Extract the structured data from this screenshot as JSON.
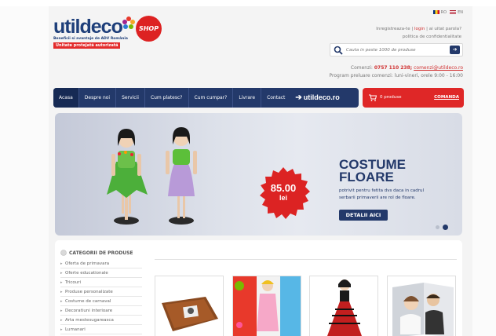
{
  "colors": {
    "brand_navy": "#23396a",
    "brand_red": "#df2727",
    "link_red": "#d03030"
  },
  "logo": {
    "word": "utildeco",
    "shop_badge": "SHOP",
    "tagline": "Beneficii si avantaje de ADV România",
    "badge": "Unitate protejată autorizată"
  },
  "languages": [
    "RO",
    "EN"
  ],
  "top_links": {
    "register": "Inregistreaza-te",
    "sep1": "|",
    "login": "login",
    "sep2": "| ai uitat parola?",
    "privacy": "politica de confidentialitate"
  },
  "search": {
    "placeholder": "Cauta in peste 1000 de produse",
    "icon": "search-icon",
    "button_icon": "arrow-right-icon"
  },
  "order_info": {
    "label": "Comenzi:",
    "phone": "0757 110 238;",
    "email": "comenzi@utildeco.ro",
    "hours": "Program preluare comenzi: luni-vineri, orele 9:00 - 16:00"
  },
  "nav": {
    "items": [
      "Acasa",
      "Despre noi",
      "Servicii",
      "Cum platesc?",
      "Cum cumpar?",
      "Livrare",
      "Contact"
    ],
    "logo_text": "utildeco.ro"
  },
  "cart": {
    "count_text": "0 produse",
    "order_label": "COMANDA",
    "icon": "cart-icon"
  },
  "banner": {
    "price_value": "85.00",
    "price_currency": "lei",
    "title_line1": "COSTUME",
    "title_line2": "FLOARE",
    "description": "potrivit pentru fetita dvs daca in cadrul serbarii primaverii are rol de floare.",
    "button": "DETALII AICI",
    "slides": 2,
    "active_slide": 2
  },
  "categories": {
    "heading": "CATEGORII DE PRODUSE",
    "items": [
      "Oferta de primavara",
      "Oferte educationale",
      "Tricouri",
      "Produse personalizate",
      "Costume de carnaval",
      "Decoratiuni interioare",
      "Arta mestesugareasca",
      "Lumanari"
    ]
  }
}
